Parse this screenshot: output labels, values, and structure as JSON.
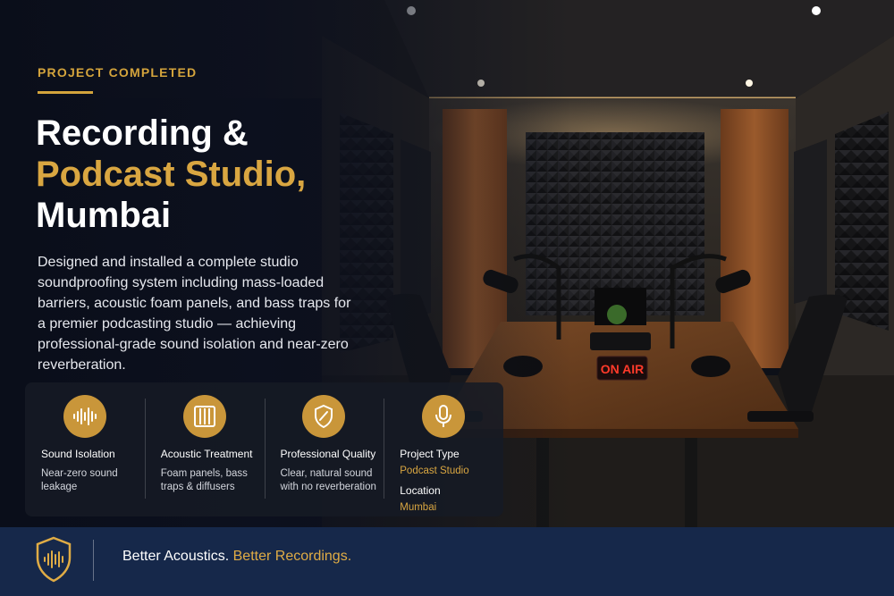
{
  "hero": {
    "eyebrow": "PROJECT COMPLETED",
    "title_line1": "Recording &",
    "title_line2": "Podcast Studio,",
    "title_line3": "Mumbai",
    "description": "Designed and installed a complete studio soundproofing system including mass-loaded barriers, acoustic foam panels, and bass traps for a premier podcasting studio — achieving professional-grade sound isolation and near-zero reverberation."
  },
  "scene": {
    "sign_text": "ON AIR"
  },
  "features": [
    {
      "icon": "sound-wave-icon",
      "title": "Sound Isolation",
      "subtitle": "Near-zero sound leakage"
    },
    {
      "icon": "acoustic-panel-icon",
      "title": "Acoustic Treatment",
      "subtitle": "Foam panels, bass traps & diffusers"
    },
    {
      "icon": "shield-check-icon",
      "title": "Professional Quality",
      "subtitle": "Clear, natural sound with no reverberation"
    },
    {
      "icon": "microphone-icon",
      "title": "Project Type",
      "value": "Podcast Studio",
      "title2": "Location",
      "value2": "Mumbai"
    }
  ],
  "footer": {
    "logo_icon": "shield-sound-wave-icon",
    "tagline_white": "Better Acoustics.",
    "tagline_gold": "Better Recordings."
  },
  "colors": {
    "gold": "#d4a43c",
    "navy": "#16284a",
    "panel": "#161a24"
  }
}
